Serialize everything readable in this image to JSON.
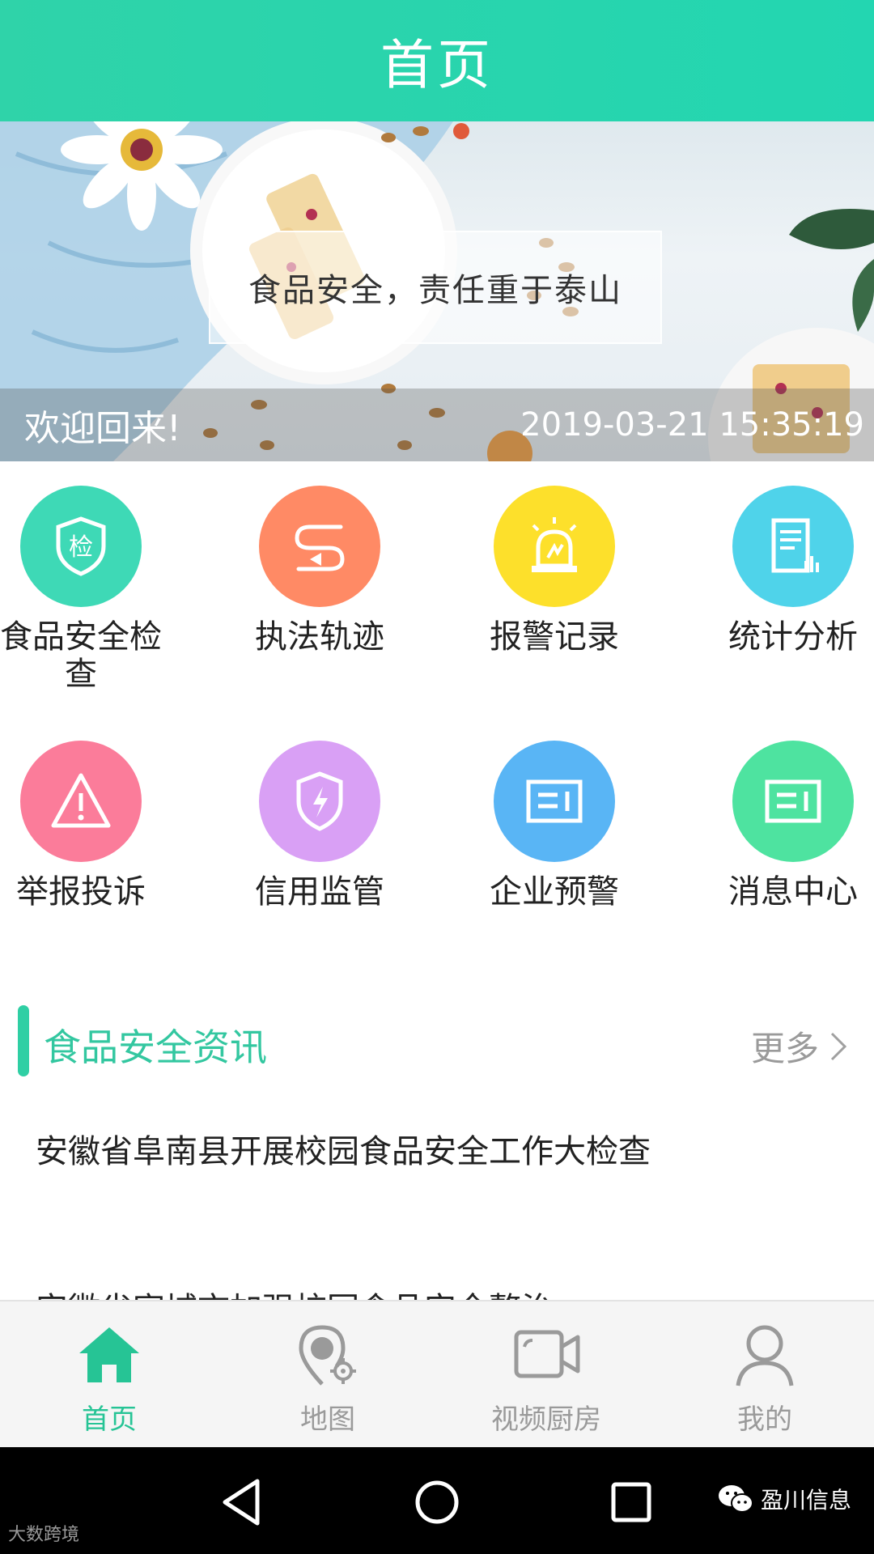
{
  "header": {
    "title": "首页"
  },
  "banner": {
    "slogan": "食品安全，责任重于泰山",
    "welcome": "欢迎回来!",
    "datetime": "2019-03-21 15:35:19"
  },
  "grid": {
    "items": [
      {
        "label": "食品安全检查",
        "icon": "shield-check-icon",
        "color": "#3ed9b6"
      },
      {
        "label": "执法轨迹",
        "icon": "route-icon",
        "color": "#ff8a65"
      },
      {
        "label": "报警记录",
        "icon": "alarm-light-icon",
        "color": "#fde02b"
      },
      {
        "label": "统计分析",
        "icon": "document-chart-icon",
        "color": "#4fd3ea"
      },
      {
        "label": "举报投诉",
        "icon": "warning-triangle-icon",
        "color": "#fb7c9a"
      },
      {
        "label": "信用监管",
        "icon": "shield-bolt-icon",
        "color": "#d9a0f5"
      },
      {
        "label": "企业预警",
        "icon": "panel-icon",
        "color": "#59b5f5"
      },
      {
        "label": "消息中心",
        "icon": "panel-icon",
        "color": "#4ee3a0"
      }
    ]
  },
  "news": {
    "title": "食品安全资讯",
    "more_label": "更多",
    "items": [
      "安徽省阜南县开展校园食品安全工作大检查",
      "安徽省宣城市加强校园食品安全整治"
    ]
  },
  "tabbar": {
    "tabs": [
      {
        "label": "首页",
        "icon": "home-icon",
        "active": true
      },
      {
        "label": "地图",
        "icon": "map-pin-icon",
        "active": false
      },
      {
        "label": "视频厨房",
        "icon": "video-camera-icon",
        "active": false
      },
      {
        "label": "我的",
        "icon": "user-icon",
        "active": false
      }
    ],
    "active_color": "#26c495",
    "inactive_color": "#9a9a9a"
  },
  "watermarks": {
    "left": "大数跨境",
    "right": "盈川信息"
  },
  "colors": {
    "brand": "#2fd3a9",
    "accent_bar": "#2fcfa4"
  }
}
